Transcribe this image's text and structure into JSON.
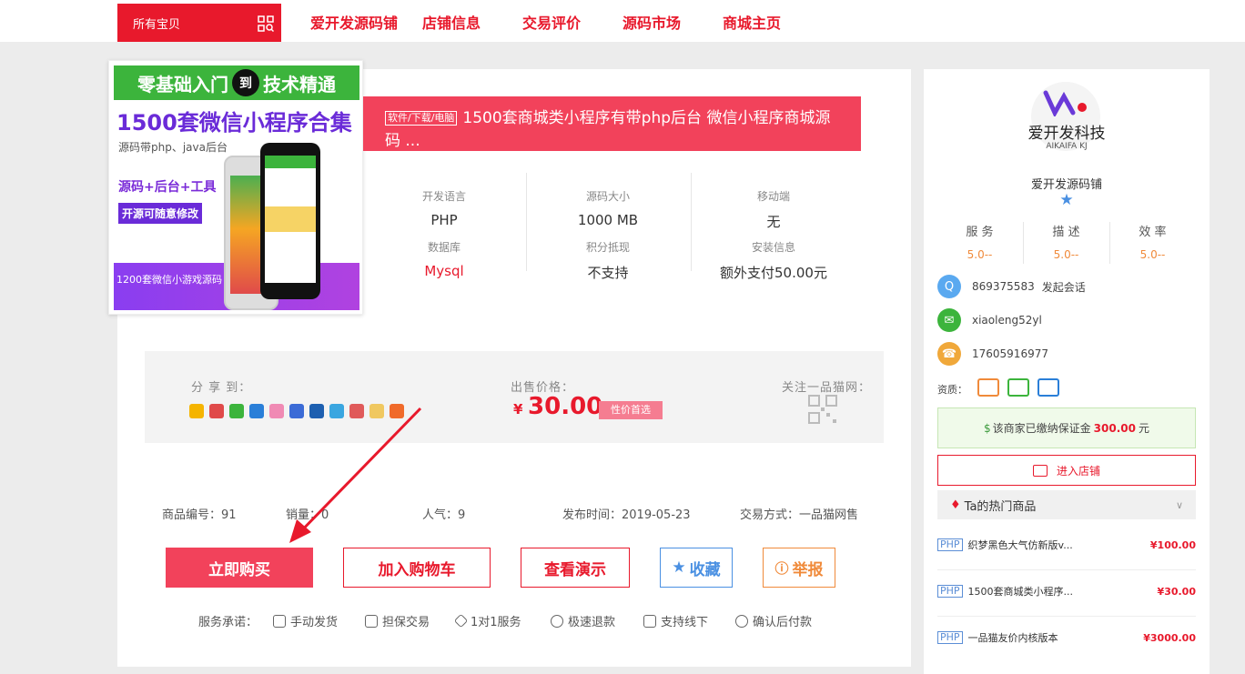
{
  "topbar": {
    "all_goods": "所有宝贝",
    "nav": [
      "爱开发源码铺",
      "店铺信息",
      "交易评价",
      "源码市场",
      "商城主页"
    ]
  },
  "product_image": {
    "line1_a": "零基础入门",
    "line1_b": "到",
    "line1_c": "技术精通",
    "line2": "1500套微信小程序合集",
    "line3": "源码带php、java后台",
    "line4": "源码+后台+工具",
    "line5": "开源可随意修改",
    "line6": "1200套微信小游戏源码"
  },
  "title": {
    "tag": "软件/下载/电脑",
    "text": "1500套商城类小程序有带php后台 微信小程序商城源码 ..."
  },
  "attributes": [
    {
      "label": "开发语言",
      "value": "PHP"
    },
    {
      "label": "源码大小",
      "value": "1000 MB"
    },
    {
      "label": "移动端",
      "value": "无"
    },
    {
      "label": "数据库",
      "value": "Mysql"
    },
    {
      "label": "积分抵现",
      "value": "不支持"
    },
    {
      "label": "安装信息",
      "value": "额外支付50.00元"
    }
  ],
  "share": {
    "label": "分 享 到："
  },
  "price": {
    "label": "出售价格：",
    "currency": "¥",
    "value": "30.00",
    "tag": "性价首选"
  },
  "follow": {
    "label": "关注一品猫网："
  },
  "info": {
    "item_no": "商品编号：91",
    "sales": "销量：0",
    "popularity": "人气：9",
    "publish": "发布时间：2019-05-23",
    "trade": "交易方式：一品猫网售"
  },
  "buttons": {
    "buy": "立即购买",
    "cart": "加入购物车",
    "demo": "查看演示",
    "fav": "收藏",
    "report": "举报"
  },
  "services": {
    "label": "服务承诺：",
    "items": [
      "手动发货",
      "担保交易",
      "1对1服务",
      "极速退款",
      "支持线下",
      "确认后付款"
    ]
  },
  "shop": {
    "logo_name": "爱开发科技",
    "logo_sub": "AIKAIFA KJ",
    "name": "爱开发源码铺",
    "scores": [
      {
        "label": "服 务",
        "value": "5.0--"
      },
      {
        "label": "描 述",
        "value": "5.0--"
      },
      {
        "label": "效 率",
        "value": "5.0--"
      }
    ],
    "qq": "869375583",
    "qq_action": "发起会话",
    "wechat": "xiaoleng52yl",
    "phone": "17605916977",
    "credentials_label": "资质：",
    "deposit_prefix": "该商家已缴纳保证金",
    "deposit_amount": "300.00",
    "deposit_unit": "元",
    "enter_shop": "进入店铺",
    "hot_title": "Ta的热门商品",
    "hot": [
      {
        "tag": "PHP",
        "name": "织梦黑色大气仿新版v...",
        "price": "¥100.00"
      },
      {
        "tag": "PHP",
        "name": "1500套商城类小程序...",
        "price": "¥30.00"
      },
      {
        "tag": "PHP",
        "name": "一品猫友价内核版本",
        "price": "¥3000.00"
      }
    ]
  },
  "colors": {
    "brand_red": "#e8192c",
    "title_red": "#f2425b",
    "blue": "#4a90e2",
    "orange": "#f08a3a"
  }
}
